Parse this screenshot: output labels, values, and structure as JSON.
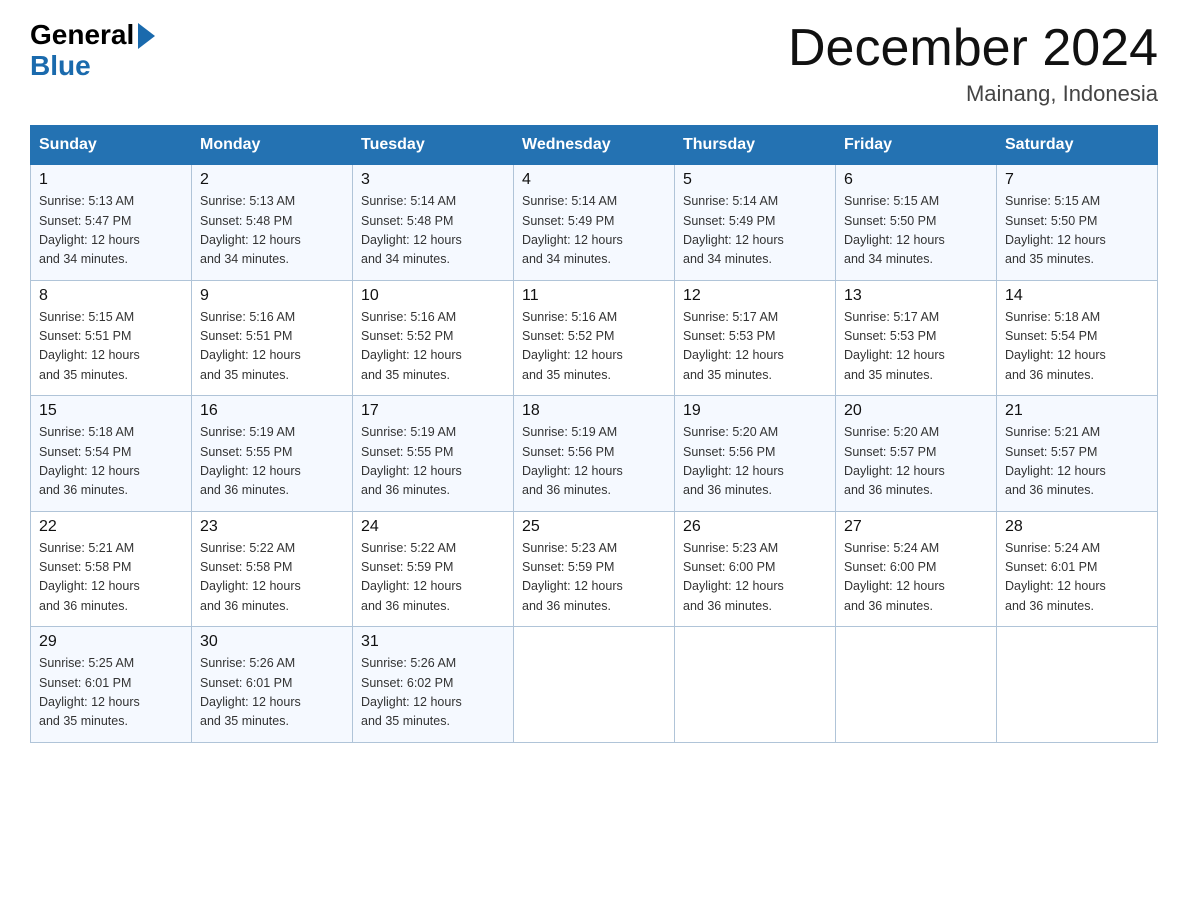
{
  "header": {
    "logo_general": "General",
    "logo_blue": "Blue",
    "month_year": "December 2024",
    "location": "Mainang, Indonesia"
  },
  "days_of_week": [
    "Sunday",
    "Monday",
    "Tuesday",
    "Wednesday",
    "Thursday",
    "Friday",
    "Saturday"
  ],
  "weeks": [
    [
      {
        "day": "1",
        "sunrise": "5:13 AM",
        "sunset": "5:47 PM",
        "daylight": "12 hours and 34 minutes."
      },
      {
        "day": "2",
        "sunrise": "5:13 AM",
        "sunset": "5:48 PM",
        "daylight": "12 hours and 34 minutes."
      },
      {
        "day": "3",
        "sunrise": "5:14 AM",
        "sunset": "5:48 PM",
        "daylight": "12 hours and 34 minutes."
      },
      {
        "day": "4",
        "sunrise": "5:14 AM",
        "sunset": "5:49 PM",
        "daylight": "12 hours and 34 minutes."
      },
      {
        "day": "5",
        "sunrise": "5:14 AM",
        "sunset": "5:49 PM",
        "daylight": "12 hours and 34 minutes."
      },
      {
        "day": "6",
        "sunrise": "5:15 AM",
        "sunset": "5:50 PM",
        "daylight": "12 hours and 34 minutes."
      },
      {
        "day": "7",
        "sunrise": "5:15 AM",
        "sunset": "5:50 PM",
        "daylight": "12 hours and 35 minutes."
      }
    ],
    [
      {
        "day": "8",
        "sunrise": "5:15 AM",
        "sunset": "5:51 PM",
        "daylight": "12 hours and 35 minutes."
      },
      {
        "day": "9",
        "sunrise": "5:16 AM",
        "sunset": "5:51 PM",
        "daylight": "12 hours and 35 minutes."
      },
      {
        "day": "10",
        "sunrise": "5:16 AM",
        "sunset": "5:52 PM",
        "daylight": "12 hours and 35 minutes."
      },
      {
        "day": "11",
        "sunrise": "5:16 AM",
        "sunset": "5:52 PM",
        "daylight": "12 hours and 35 minutes."
      },
      {
        "day": "12",
        "sunrise": "5:17 AM",
        "sunset": "5:53 PM",
        "daylight": "12 hours and 35 minutes."
      },
      {
        "day": "13",
        "sunrise": "5:17 AM",
        "sunset": "5:53 PM",
        "daylight": "12 hours and 35 minutes."
      },
      {
        "day": "14",
        "sunrise": "5:18 AM",
        "sunset": "5:54 PM",
        "daylight": "12 hours and 36 minutes."
      }
    ],
    [
      {
        "day": "15",
        "sunrise": "5:18 AM",
        "sunset": "5:54 PM",
        "daylight": "12 hours and 36 minutes."
      },
      {
        "day": "16",
        "sunrise": "5:19 AM",
        "sunset": "5:55 PM",
        "daylight": "12 hours and 36 minutes."
      },
      {
        "day": "17",
        "sunrise": "5:19 AM",
        "sunset": "5:55 PM",
        "daylight": "12 hours and 36 minutes."
      },
      {
        "day": "18",
        "sunrise": "5:19 AM",
        "sunset": "5:56 PM",
        "daylight": "12 hours and 36 minutes."
      },
      {
        "day": "19",
        "sunrise": "5:20 AM",
        "sunset": "5:56 PM",
        "daylight": "12 hours and 36 minutes."
      },
      {
        "day": "20",
        "sunrise": "5:20 AM",
        "sunset": "5:57 PM",
        "daylight": "12 hours and 36 minutes."
      },
      {
        "day": "21",
        "sunrise": "5:21 AM",
        "sunset": "5:57 PM",
        "daylight": "12 hours and 36 minutes."
      }
    ],
    [
      {
        "day": "22",
        "sunrise": "5:21 AM",
        "sunset": "5:58 PM",
        "daylight": "12 hours and 36 minutes."
      },
      {
        "day": "23",
        "sunrise": "5:22 AM",
        "sunset": "5:58 PM",
        "daylight": "12 hours and 36 minutes."
      },
      {
        "day": "24",
        "sunrise": "5:22 AM",
        "sunset": "5:59 PM",
        "daylight": "12 hours and 36 minutes."
      },
      {
        "day": "25",
        "sunrise": "5:23 AM",
        "sunset": "5:59 PM",
        "daylight": "12 hours and 36 minutes."
      },
      {
        "day": "26",
        "sunrise": "5:23 AM",
        "sunset": "6:00 PM",
        "daylight": "12 hours and 36 minutes."
      },
      {
        "day": "27",
        "sunrise": "5:24 AM",
        "sunset": "6:00 PM",
        "daylight": "12 hours and 36 minutes."
      },
      {
        "day": "28",
        "sunrise": "5:24 AM",
        "sunset": "6:01 PM",
        "daylight": "12 hours and 36 minutes."
      }
    ],
    [
      {
        "day": "29",
        "sunrise": "5:25 AM",
        "sunset": "6:01 PM",
        "daylight": "12 hours and 35 minutes."
      },
      {
        "day": "30",
        "sunrise": "5:26 AM",
        "sunset": "6:01 PM",
        "daylight": "12 hours and 35 minutes."
      },
      {
        "day": "31",
        "sunrise": "5:26 AM",
        "sunset": "6:02 PM",
        "daylight": "12 hours and 35 minutes."
      },
      null,
      null,
      null,
      null
    ]
  ],
  "cell_labels": {
    "sunrise": "Sunrise:",
    "sunset": "Sunset:",
    "daylight": "Daylight:"
  }
}
